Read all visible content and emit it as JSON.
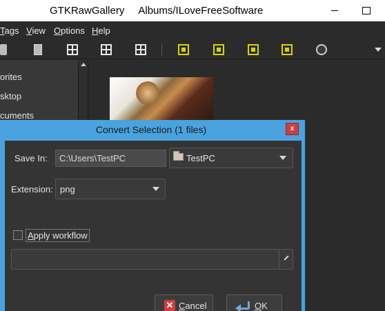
{
  "window": {
    "title": "GTKRawGallery     Albums/ILoveFreeSoftware"
  },
  "menubar": {
    "items": [
      "Tags",
      "View",
      "Options",
      "Help"
    ]
  },
  "toolbar": {
    "icons": [
      "camera-icon",
      "document-icon",
      "grid-view-icon",
      "grid-view-icon",
      "grid-view-icon",
      "filmstrip-icon",
      "filmstrip-icon",
      "filmstrip-icon",
      "filmstrip-icon",
      "settings-icon",
      "more-icon"
    ]
  },
  "sidebar": {
    "items": [
      "orites",
      "sktop",
      "cuments"
    ]
  },
  "dialog": {
    "title": "Convert Selection  (1 files)",
    "close_label": "x",
    "save_in_label": "Save In:",
    "save_in_path": "C:\\Users\\TestPC",
    "folder_combo_value": "TestPC",
    "extension_label": "Extension:",
    "extension_value": "png",
    "apply_workflow_label": "Apply workflow",
    "apply_workflow_checked": false,
    "workflow_value": "",
    "cancel_label": "Cancel",
    "ok_label": "OK"
  },
  "colors": {
    "dialog_border": "#4aa3df",
    "dialog_bg": "#343434",
    "close_button": "#c9403f",
    "toolbar_yellow": "#d6d600"
  }
}
